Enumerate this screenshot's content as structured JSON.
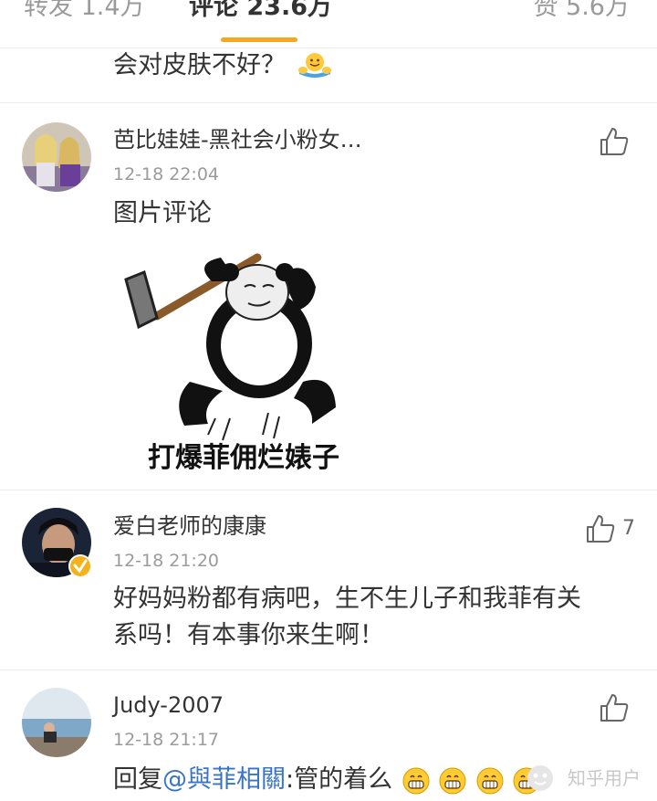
{
  "tabs": {
    "repost": "转发 1.4万",
    "comments": "评论 23.6万",
    "likes": "赞 5.6万"
  },
  "partial_comment": {
    "text": "会对皮肤不好？"
  },
  "comments": [
    {
      "username": "芭比娃娃-黑社会小粉女…",
      "time": "12-18 22:04",
      "text": "图片评论",
      "image_caption": "打爆菲佣烂婊子",
      "like_count": ""
    },
    {
      "username": "爱白老师的康康",
      "time": "12-18 21:20",
      "text_line1": "好妈妈粉都有病吧，生不生儿子和我菲有关",
      "text_line2": "系吗！有本事你来生啊！",
      "like_count": "7"
    },
    {
      "username": "Judy-2007",
      "time": "12-18 21:17",
      "reply_prefix": "回复",
      "mention": "@與菲相關",
      "reply_body": ":管的着么"
    }
  ],
  "watermark": "知乎用户"
}
